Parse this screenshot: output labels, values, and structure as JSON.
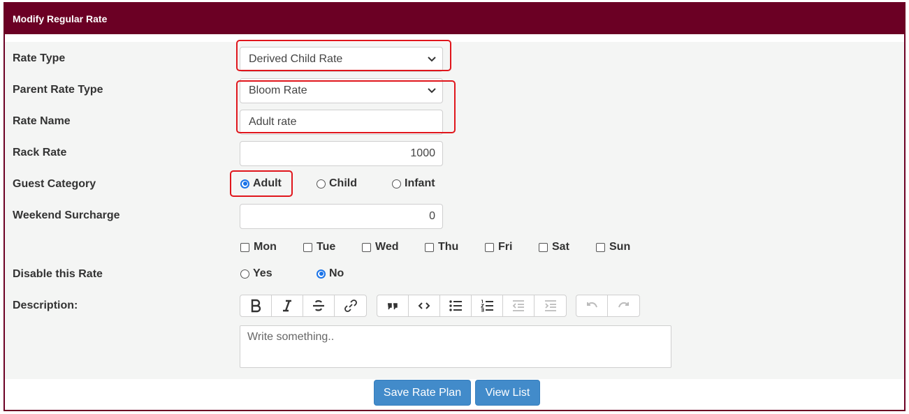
{
  "panel": {
    "title": "Modify Regular Rate"
  },
  "form": {
    "rate_type": {
      "label": "Rate Type",
      "value": "Derived Child Rate"
    },
    "parent_rate_type": {
      "label": "Parent Rate Type",
      "value": "Bloom Rate"
    },
    "rate_name": {
      "label": "Rate Name",
      "value": "Adult rate"
    },
    "rack_rate": {
      "label": "Rack Rate",
      "value": "1000"
    },
    "guest_category": {
      "label": "Guest Category",
      "options": [
        "Adult",
        "Child",
        "Infant"
      ],
      "selected": "Adult"
    },
    "weekend_surcharge": {
      "label": "Weekend Surcharge",
      "value": "0"
    },
    "days": [
      "Mon",
      "Tue",
      "Wed",
      "Thu",
      "Fri",
      "Sat",
      "Sun"
    ],
    "disable_rate": {
      "label": "Disable this Rate",
      "options": [
        "Yes",
        "No"
      ],
      "selected": "No"
    },
    "description": {
      "label": "Description:",
      "placeholder": "Write something.."
    }
  },
  "toolbar": {
    "icons": [
      "bold-icon",
      "italic-icon",
      "strikethrough-icon",
      "link-icon",
      "quote-icon",
      "code-icon",
      "bulleted-list-icon",
      "numbered-list-icon",
      "outdent-icon",
      "indent-icon",
      "undo-icon",
      "redo-icon"
    ]
  },
  "actions": {
    "save": "Save Rate Plan",
    "view_list": "View List"
  },
  "colors": {
    "header": "#6b0024",
    "accent": "#428bca",
    "highlight": "#e0161c",
    "radio": "#1a73e8"
  }
}
